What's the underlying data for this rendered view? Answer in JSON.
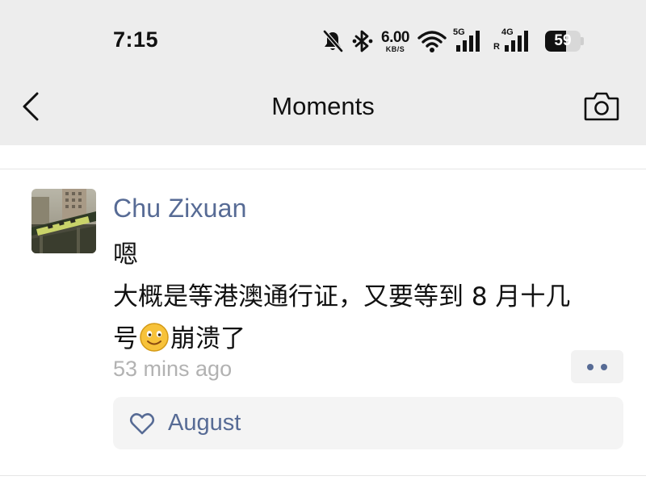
{
  "status_bar": {
    "time": "7:15",
    "net_speed": "6.00",
    "net_speed_unit": "KB/S",
    "sim1_label": "5G",
    "sim2_label": "4G",
    "sim2_roaming": "R",
    "battery": "59",
    "icons": [
      "mute-icon",
      "bluetooth-icon",
      "wifi-icon",
      "signal-5g-icon",
      "signal-4g-icon",
      "battery-icon"
    ]
  },
  "nav": {
    "title": "Moments",
    "back_icon": "chevron-left-icon",
    "camera_icon": "camera-icon"
  },
  "post": {
    "author": "Chu Zixuan",
    "lines": [
      "嗯",
      "大概是等港澳通行证，又要等到 8 月十几"
    ],
    "line3_before": "号",
    "line3_emoji": "smile-emoji",
    "line3_after": "崩溃了",
    "time_ago": "53 mins ago",
    "more_icon": "more-dots-icon",
    "likes": {
      "icon": "heart-outline-icon",
      "names": "August"
    }
  },
  "colors": {
    "header_bg": "#ededed",
    "link_blue": "#576b95",
    "meta_gray": "#b2b2b2",
    "likes_bg": "#f4f4f4"
  }
}
